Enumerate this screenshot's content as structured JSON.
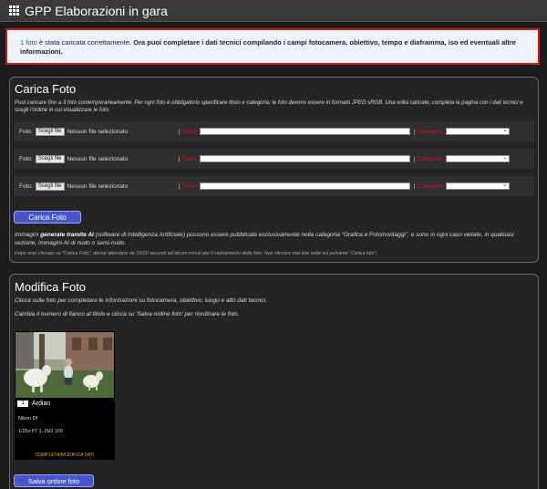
{
  "header": {
    "title": "GPP Elaborazioni in gara",
    "icon": "grid-icon"
  },
  "notice": {
    "count": "1 foto",
    "text": " è stata caricata correttamente. ",
    "bold": "Ora puoi completare i dati tecnici compilando i campi fotocamera, obiettivo, tempo e diaframma, iso ed eventuali altre informazioni."
  },
  "upload": {
    "title": "Carica Foto",
    "description": "Puoi caricare fino a 3 foto contemporaneamente. Per ogni foto è obbligatorio specificare titolo e categoria; le foto devono essere in formato JPEG sRGB. Una volta caricate, completa la pagina con i dati tecnici e scegli l'ordine in cui visualizzare le foto.",
    "rows": [
      {
        "label": "Foto:",
        "button": "Scegli file",
        "file_status": "Nessun file selezionato",
        "title_label": "Titolo:",
        "category_label": "Categoria:"
      },
      {
        "label": "Foto:",
        "button": "Scegli file",
        "file_status": "Nessun file selezionato",
        "title_label": "Titolo:",
        "category_label": "Categoria:"
      },
      {
        "label": "Foto:",
        "button": "Scegli file",
        "file_status": "Nessun file selezionato",
        "title_label": "Titolo:",
        "category_label": "Categoria:"
      }
    ],
    "separator": "|",
    "submit_label": "Carica Foto",
    "ai_intro": "Immagini ",
    "ai_bold": "generate tramite AI",
    "ai_rest": " (software di Intelligenza Artificiale) possono essere pubblicate esclusivamente nella categoria \"Grafica e Fotomontaggi\", e sono in ogni caso vietate, in qualsiasi sezione, immagini AI di nudo o semi-nudo.",
    "wait_note": "Dopo aver cliccato su \"Carica Foto\", dovrai attendere da 10/20 secondi ad alcuni minuti per il caricamento delle foto. Non cliccare mai due volte sul pulsante \"Carica foto\"."
  },
  "edit": {
    "title": "Modifica Foto",
    "line1": "Clicca sulle foto per completare le informazioni su fotocamera, obiettivo, luogo e altri dati tecnici.",
    "line2": "Cambia il numero di fianco al titolo e clicca su 'Salva ordine foto' per riordinare le foto.",
    "photos": [
      {
        "order": "1",
        "title": "Ardian",
        "camera": "Nikon Df",
        "exif": "1/25s f/7.1. ISO 100",
        "link": "COMPLETA/MODIFICA DATI"
      }
    ],
    "save_label": "Salva ordine foto"
  },
  "colors": {
    "notice_border": "#d01818",
    "button": "#4a56c8",
    "link": "#e6a92a",
    "required": "#d01818"
  }
}
